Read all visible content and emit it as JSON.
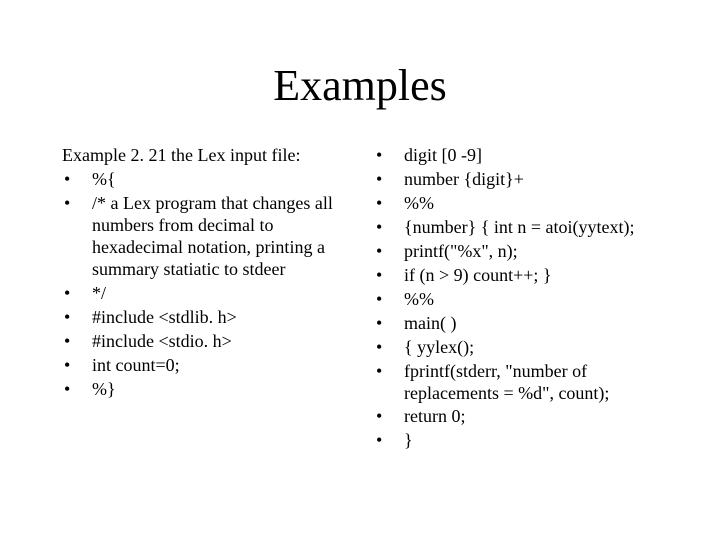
{
  "title": "Examples",
  "left": {
    "intro": "Example 2. 21 the Lex input file:",
    "items": [
      "       %{",
      "       /*  a Lex program that changes all numbers from decimal to hexadecimal notation,  printing a summary statiatic to stdeer",
      "      */",
      "      #include  <stdlib. h>",
      "     #include  <stdio. h>",
      "     int  count=0;",
      "     %}"
    ]
  },
  "right": {
    "items": [
      "        digit   [0 -9]",
      "        number   {digit}+",
      "    %%",
      "       {number} { int  n = atoi(yytext);",
      "            printf(\"%x\", n);",
      "            if (n > 9) count++; }",
      "    %%",
      "    main( )",
      "    { yylex();",
      "     fprintf(stderr, \"number of replacements = %d\", count);",
      "     return 0;",
      "    }"
    ]
  }
}
